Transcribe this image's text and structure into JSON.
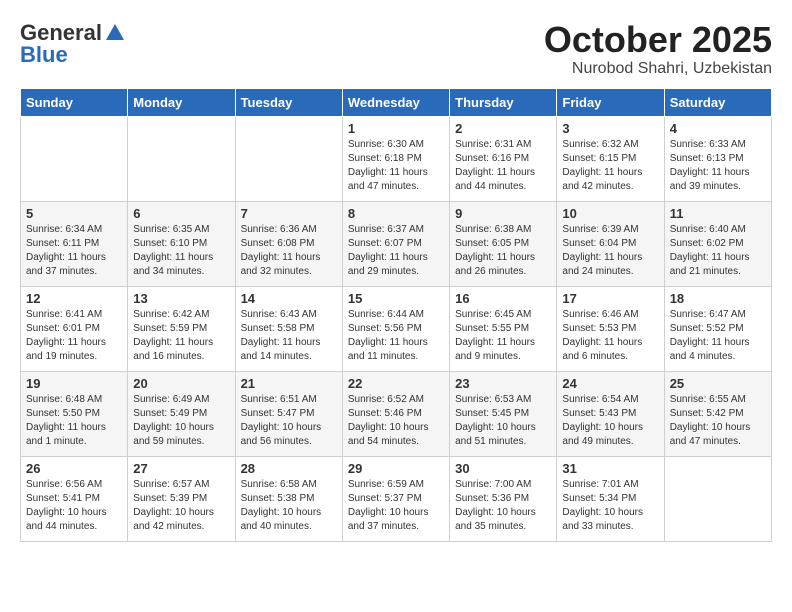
{
  "header": {
    "logo_general": "General",
    "logo_blue": "Blue",
    "month_title": "October 2025",
    "subtitle": "Nurobod Shahri, Uzbekistan"
  },
  "weekdays": [
    "Sunday",
    "Monday",
    "Tuesday",
    "Wednesday",
    "Thursday",
    "Friday",
    "Saturday"
  ],
  "weeks": [
    [
      {
        "day": "",
        "info": ""
      },
      {
        "day": "",
        "info": ""
      },
      {
        "day": "",
        "info": ""
      },
      {
        "day": "1",
        "info": "Sunrise: 6:30 AM\nSunset: 6:18 PM\nDaylight: 11 hours\nand 47 minutes."
      },
      {
        "day": "2",
        "info": "Sunrise: 6:31 AM\nSunset: 6:16 PM\nDaylight: 11 hours\nand 44 minutes."
      },
      {
        "day": "3",
        "info": "Sunrise: 6:32 AM\nSunset: 6:15 PM\nDaylight: 11 hours\nand 42 minutes."
      },
      {
        "day": "4",
        "info": "Sunrise: 6:33 AM\nSunset: 6:13 PM\nDaylight: 11 hours\nand 39 minutes."
      }
    ],
    [
      {
        "day": "5",
        "info": "Sunrise: 6:34 AM\nSunset: 6:11 PM\nDaylight: 11 hours\nand 37 minutes."
      },
      {
        "day": "6",
        "info": "Sunrise: 6:35 AM\nSunset: 6:10 PM\nDaylight: 11 hours\nand 34 minutes."
      },
      {
        "day": "7",
        "info": "Sunrise: 6:36 AM\nSunset: 6:08 PM\nDaylight: 11 hours\nand 32 minutes."
      },
      {
        "day": "8",
        "info": "Sunrise: 6:37 AM\nSunset: 6:07 PM\nDaylight: 11 hours\nand 29 minutes."
      },
      {
        "day": "9",
        "info": "Sunrise: 6:38 AM\nSunset: 6:05 PM\nDaylight: 11 hours\nand 26 minutes."
      },
      {
        "day": "10",
        "info": "Sunrise: 6:39 AM\nSunset: 6:04 PM\nDaylight: 11 hours\nand 24 minutes."
      },
      {
        "day": "11",
        "info": "Sunrise: 6:40 AM\nSunset: 6:02 PM\nDaylight: 11 hours\nand 21 minutes."
      }
    ],
    [
      {
        "day": "12",
        "info": "Sunrise: 6:41 AM\nSunset: 6:01 PM\nDaylight: 11 hours\nand 19 minutes."
      },
      {
        "day": "13",
        "info": "Sunrise: 6:42 AM\nSunset: 5:59 PM\nDaylight: 11 hours\nand 16 minutes."
      },
      {
        "day": "14",
        "info": "Sunrise: 6:43 AM\nSunset: 5:58 PM\nDaylight: 11 hours\nand 14 minutes."
      },
      {
        "day": "15",
        "info": "Sunrise: 6:44 AM\nSunset: 5:56 PM\nDaylight: 11 hours\nand 11 minutes."
      },
      {
        "day": "16",
        "info": "Sunrise: 6:45 AM\nSunset: 5:55 PM\nDaylight: 11 hours\nand 9 minutes."
      },
      {
        "day": "17",
        "info": "Sunrise: 6:46 AM\nSunset: 5:53 PM\nDaylight: 11 hours\nand 6 minutes."
      },
      {
        "day": "18",
        "info": "Sunrise: 6:47 AM\nSunset: 5:52 PM\nDaylight: 11 hours\nand 4 minutes."
      }
    ],
    [
      {
        "day": "19",
        "info": "Sunrise: 6:48 AM\nSunset: 5:50 PM\nDaylight: 11 hours\nand 1 minute."
      },
      {
        "day": "20",
        "info": "Sunrise: 6:49 AM\nSunset: 5:49 PM\nDaylight: 10 hours\nand 59 minutes."
      },
      {
        "day": "21",
        "info": "Sunrise: 6:51 AM\nSunset: 5:47 PM\nDaylight: 10 hours\nand 56 minutes."
      },
      {
        "day": "22",
        "info": "Sunrise: 6:52 AM\nSunset: 5:46 PM\nDaylight: 10 hours\nand 54 minutes."
      },
      {
        "day": "23",
        "info": "Sunrise: 6:53 AM\nSunset: 5:45 PM\nDaylight: 10 hours\nand 51 minutes."
      },
      {
        "day": "24",
        "info": "Sunrise: 6:54 AM\nSunset: 5:43 PM\nDaylight: 10 hours\nand 49 minutes."
      },
      {
        "day": "25",
        "info": "Sunrise: 6:55 AM\nSunset: 5:42 PM\nDaylight: 10 hours\nand 47 minutes."
      }
    ],
    [
      {
        "day": "26",
        "info": "Sunrise: 6:56 AM\nSunset: 5:41 PM\nDaylight: 10 hours\nand 44 minutes."
      },
      {
        "day": "27",
        "info": "Sunrise: 6:57 AM\nSunset: 5:39 PM\nDaylight: 10 hours\nand 42 minutes."
      },
      {
        "day": "28",
        "info": "Sunrise: 6:58 AM\nSunset: 5:38 PM\nDaylight: 10 hours\nand 40 minutes."
      },
      {
        "day": "29",
        "info": "Sunrise: 6:59 AM\nSunset: 5:37 PM\nDaylight: 10 hours\nand 37 minutes."
      },
      {
        "day": "30",
        "info": "Sunrise: 7:00 AM\nSunset: 5:36 PM\nDaylight: 10 hours\nand 35 minutes."
      },
      {
        "day": "31",
        "info": "Sunrise: 7:01 AM\nSunset: 5:34 PM\nDaylight: 10 hours\nand 33 minutes."
      },
      {
        "day": "",
        "info": ""
      }
    ]
  ]
}
